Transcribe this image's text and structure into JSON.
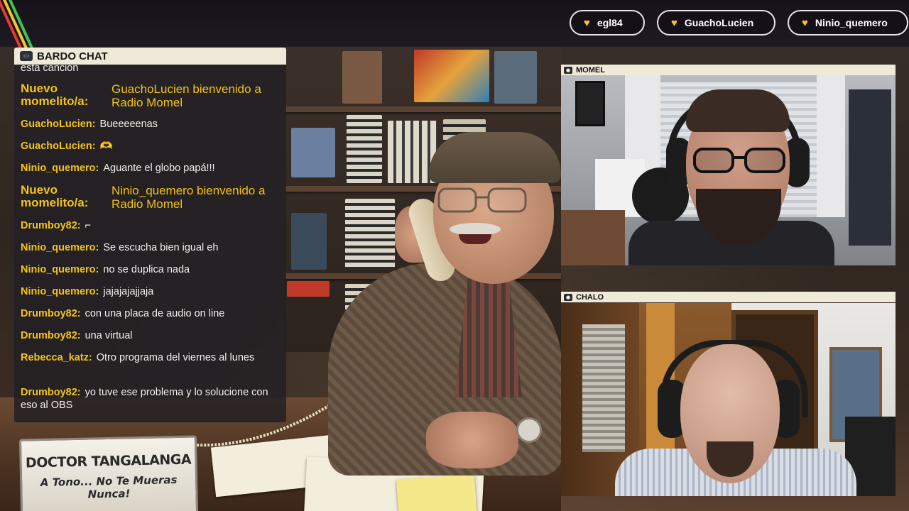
{
  "top_users": [
    {
      "name": "egl84",
      "icon": "heart-icon"
    },
    {
      "name": "GuachoLucien",
      "icon": "heart-icon"
    },
    {
      "name": "Ninio_quemero",
      "icon": "heart-icon"
    }
  ],
  "chat": {
    "title": "BARDO CHAT",
    "messages": [
      {
        "user": "",
        "text": "esta canción",
        "kind": "partial"
      },
      {
        "user": "Nuevo momelito/a:",
        "text": "GuachoLucien bienvenido a Radio Momel",
        "kind": "welcome"
      },
      {
        "user": "GuachoLucien:",
        "text": "Bueeeeenas"
      },
      {
        "user": "GuachoLucien:",
        "text": "🫶"
      },
      {
        "user": "Ninio_quemero:",
        "text": "Aguante el globo papá!!!"
      },
      {
        "user": "Nuevo momelito/a:",
        "text": "Ninio_quemero bienvenido a Radio Momel",
        "kind": "welcome"
      },
      {
        "user": "Drumboy82:",
        "text": "⌐"
      },
      {
        "user": "Ninio_quemero:",
        "text": "Se escucha bien igual eh"
      },
      {
        "user": "Ninio_quemero:",
        "text": "no se duplica nada"
      },
      {
        "user": "Ninio_quemero:",
        "text": "jajajajajjaja"
      },
      {
        "user": "Drumboy82:",
        "text": "con una placa de audio on line"
      },
      {
        "user": "Drumboy82:",
        "text": "una virtual"
      },
      {
        "user": "Rebecca_katz:",
        "text": "Otro programa del viernes al lunes"
      },
      {
        "user": "Drumboy82:",
        "text": "yo tuve ese problema y lo solucione con eso al OBS"
      }
    ]
  },
  "cams": {
    "momel": {
      "label": "MOMEL"
    },
    "chalo": {
      "label": "CHALO"
    }
  },
  "nameplate": {
    "line1": "DOCTOR TANGALANGA",
    "line2": "A Tono... No Te Mueras Nunca!"
  },
  "colors": {
    "accent_yellow": "#f3c31a",
    "chat_bg": "#232024",
    "label_bg": "#efe9d8"
  }
}
